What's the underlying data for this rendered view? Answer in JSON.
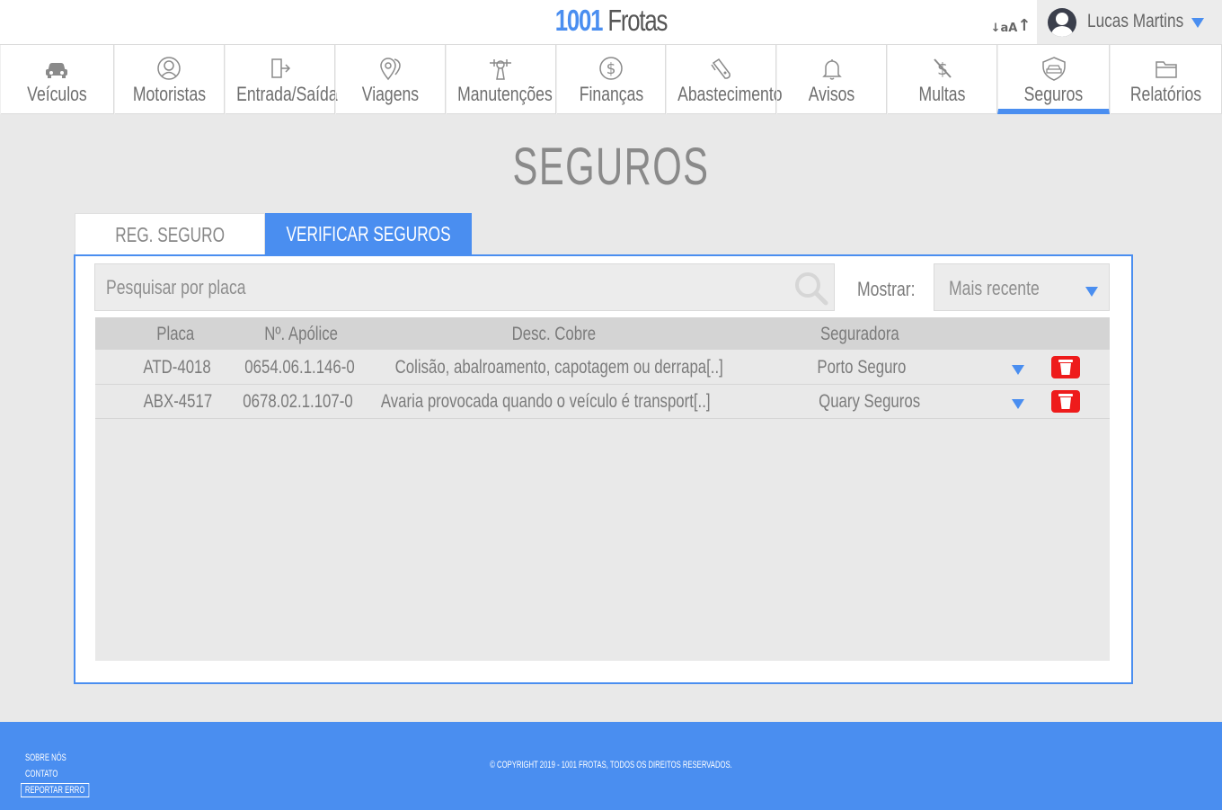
{
  "brand": {
    "number": "1001",
    "name": " Frotas"
  },
  "header": {
    "font_small": "↓aA",
    "font_big": "↑"
  },
  "user": {
    "name": "Lucas Martins"
  },
  "nav": {
    "items": [
      {
        "label": "Veículos",
        "icon": "car-icon"
      },
      {
        "label": "Motoristas",
        "icon": "driver-icon"
      },
      {
        "label": "Entrada/Saída",
        "icon": "door-exit-icon"
      },
      {
        "label": "Viagens",
        "icon": "map-pins-icon"
      },
      {
        "label": "Manutenções",
        "icon": "wrench-icon"
      },
      {
        "label": "Finanças",
        "icon": "dollar-icon"
      },
      {
        "label": "Abastecimento",
        "icon": "fuel-nozzle-icon"
      },
      {
        "label": "Avisos",
        "icon": "bell-icon"
      },
      {
        "label": "Multas",
        "icon": "fine-icon"
      },
      {
        "label": "Seguros",
        "icon": "insurance-icon",
        "active": true
      },
      {
        "label": "Relatórios",
        "icon": "folder-icon"
      }
    ]
  },
  "page": {
    "title": "SEGUROS"
  },
  "tabs": {
    "register": "REG. SEGURO",
    "verify": "VERIFICAR SEGUROS"
  },
  "search": {
    "placeholder": "Pesquisar por placa",
    "value": ""
  },
  "filter": {
    "label": "Mostrar:",
    "selected": "Mais recente"
  },
  "table": {
    "headers": {
      "placa": "Placa",
      "apolice": "Nº. Apólice",
      "desc": "Desc. Cobre",
      "seguradora": "Seguradora"
    },
    "rows": [
      {
        "placa": "ATD-4018",
        "apolice": "0654.06.1.146-0",
        "desc": "Colisão, abalroamento, capotagem ou derrapa[..]",
        "seguradora": "Porto Seguro"
      },
      {
        "placa": "ABX-4517",
        "apolice": "0678.02.1.107-0",
        "desc": "Avaria provocada quando o veículo é transport[..]",
        "seguradora": "Quary Seguros"
      }
    ]
  },
  "footer": {
    "about": "SOBRE NÓS",
    "contact": "CONTATO",
    "report": "REPORTAR ERRO",
    "copyright": "© COPYRIGHT 2019 - 1001 FROTAS, TODOS OS DIREITOS RESERVADOS."
  },
  "colors": {
    "accent": "#4a8ef0",
    "danger": "#ee1b1b",
    "background": "#e9e9e9"
  }
}
